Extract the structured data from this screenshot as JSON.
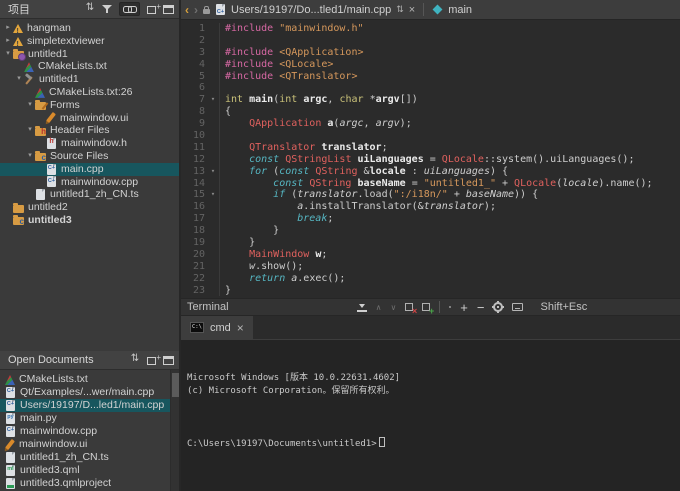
{
  "colors": {
    "selection_teal": "#17565e",
    "warning_yellow": "#e3a63c",
    "accent_teal": "#3fb3c0",
    "syntax_preprocessor": "#d668a3",
    "syntax_string": "#d6985c",
    "syntax_keyword_type": "#c9c179",
    "syntax_keyword_control": "#56b6c2",
    "syntax_qt_type": "#e0615e",
    "editor_bg": "#2b2b2b",
    "terminal_bg": "#242424",
    "panel_bg": "#3a3a3a"
  },
  "project_panel": {
    "title": "项目",
    "tree": [
      {
        "label": "hangman",
        "level": 0,
        "arrow": "collapsed",
        "icon": "warning"
      },
      {
        "label": "simpletextviewer",
        "level": 0,
        "arrow": "collapsed",
        "icon": "warning"
      },
      {
        "label": "untitled1",
        "level": 0,
        "arrow": "expanded",
        "icon": "folder-project"
      },
      {
        "label": "CMakeLists.txt",
        "level": 1,
        "arrow": "none",
        "icon": "cmake"
      },
      {
        "label": "untitled1",
        "level": 1,
        "arrow": "expanded",
        "icon": "hammer"
      },
      {
        "label": "CMakeLists.txt:26",
        "level": 2,
        "arrow": "none",
        "icon": "cmake"
      },
      {
        "label": "Forms",
        "level": 2,
        "arrow": "expanded",
        "icon": "folder-ui"
      },
      {
        "label": "mainwindow.ui",
        "level": 3,
        "arrow": "none",
        "icon": "ui"
      },
      {
        "label": "Header Files",
        "level": 2,
        "arrow": "expanded",
        "icon": "folder-h"
      },
      {
        "label": "mainwindow.h",
        "level": 3,
        "arrow": "none",
        "icon": "h"
      },
      {
        "label": "Source Files",
        "level": 2,
        "arrow": "expanded",
        "icon": "folder-c"
      },
      {
        "label": "main.cpp",
        "level": 3,
        "arrow": "none",
        "icon": "cpp",
        "selected": true
      },
      {
        "label": "mainwindow.cpp",
        "level": 3,
        "arrow": "none",
        "icon": "cpp"
      },
      {
        "label": "untitled1_zh_CN.ts",
        "level": 2,
        "arrow": "none",
        "icon": "doc"
      },
      {
        "label": "untitled2",
        "level": 0,
        "arrow": "none",
        "icon": "folder"
      },
      {
        "label": "untitled3",
        "level": 0,
        "arrow": "none",
        "icon": "folder-qml",
        "bold": true
      }
    ]
  },
  "open_documents": {
    "title": "Open Documents",
    "items": [
      {
        "label": "CMakeLists.txt",
        "icon": "cmake"
      },
      {
        "label": "Qt/Examples/...wer/main.cpp",
        "icon": "cpp"
      },
      {
        "label": "Users/19197/D...led1/main.cpp",
        "icon": "cpp",
        "selected": true
      },
      {
        "label": "main.py",
        "icon": "py"
      },
      {
        "label": "mainwindow.cpp",
        "icon": "cpp"
      },
      {
        "label": "mainwindow.ui",
        "icon": "ui"
      },
      {
        "label": "untitled1_zh_CN.ts",
        "icon": "doc"
      },
      {
        "label": "untitled3.qml",
        "icon": "qml"
      },
      {
        "label": "untitled3.qmlproject",
        "icon": "qmlproject"
      }
    ]
  },
  "editor": {
    "document_tab": {
      "label": "Users/19197/Do...tled1/main.cpp"
    },
    "symbol_tab": {
      "label": "main"
    },
    "fold_lines": [
      7,
      13,
      15
    ],
    "lines": [
      [
        [
          "pp",
          "#include"
        ],
        [
          "n",
          " "
        ],
        [
          "s",
          "\"mainwindow.h\""
        ]
      ],
      [],
      [
        [
          "pp",
          "#include"
        ],
        [
          "n",
          " "
        ],
        [
          "s",
          "<QApplication>"
        ]
      ],
      [
        [
          "pp",
          "#include"
        ],
        [
          "n",
          " "
        ],
        [
          "s",
          "<QLocale>"
        ]
      ],
      [
        [
          "pp",
          "#include"
        ],
        [
          "n",
          " "
        ],
        [
          "s",
          "<QTranslator>"
        ]
      ],
      [],
      [
        [
          "k",
          "int"
        ],
        [
          "n",
          " "
        ],
        [
          "d",
          "main"
        ],
        [
          "n",
          "("
        ],
        [
          "k",
          "int"
        ],
        [
          "n",
          " "
        ],
        [
          "d",
          "argc"
        ],
        [
          "n",
          ", "
        ],
        [
          "k",
          "char"
        ],
        [
          "n",
          " *"
        ],
        [
          "d",
          "argv"
        ],
        [
          "n",
          "[])"
        ]
      ],
      [
        [
          "n",
          "{"
        ]
      ],
      [
        [
          "n",
          "    "
        ],
        [
          "t",
          "QApplication"
        ],
        [
          "n",
          " "
        ],
        [
          "d",
          "a"
        ],
        [
          "n",
          "("
        ],
        [
          "u",
          "argc"
        ],
        [
          "n",
          ", "
        ],
        [
          "u",
          "argv"
        ],
        [
          "n",
          ");"
        ]
      ],
      [],
      [
        [
          "n",
          "    "
        ],
        [
          "t",
          "QTranslator"
        ],
        [
          "n",
          " "
        ],
        [
          "d",
          "translator"
        ],
        [
          "n",
          ";"
        ]
      ],
      [
        [
          "n",
          "    "
        ],
        [
          "c",
          "const"
        ],
        [
          "n",
          " "
        ],
        [
          "t",
          "QStringList"
        ],
        [
          "n",
          " "
        ],
        [
          "d",
          "uiLanguages"
        ],
        [
          "n",
          " = "
        ],
        [
          "t",
          "QLocale"
        ],
        [
          "n",
          "::system().uiLanguages();"
        ]
      ],
      [
        [
          "n",
          "    "
        ],
        [
          "c",
          "for"
        ],
        [
          "n",
          " ("
        ],
        [
          "c",
          "const"
        ],
        [
          "n",
          " "
        ],
        [
          "t",
          "QString"
        ],
        [
          "n",
          " &"
        ],
        [
          "d",
          "locale"
        ],
        [
          "n",
          " : "
        ],
        [
          "u",
          "uiLanguages"
        ],
        [
          "n",
          ") {"
        ]
      ],
      [
        [
          "n",
          "        "
        ],
        [
          "c",
          "const"
        ],
        [
          "n",
          " "
        ],
        [
          "t",
          "QString"
        ],
        [
          "n",
          " "
        ],
        [
          "d",
          "baseName"
        ],
        [
          "n",
          " = "
        ],
        [
          "s",
          "\"untitled1_\""
        ],
        [
          "n",
          " + "
        ],
        [
          "t",
          "QLocale"
        ],
        [
          "n",
          "("
        ],
        [
          "u",
          "locale"
        ],
        [
          "n",
          ").name();"
        ]
      ],
      [
        [
          "n",
          "        "
        ],
        [
          "c",
          "if"
        ],
        [
          "n",
          " ("
        ],
        [
          "u",
          "translator"
        ],
        [
          "n",
          ".load("
        ],
        [
          "s",
          "\":/i18n/\""
        ],
        [
          "n",
          " + "
        ],
        [
          "u",
          "baseName"
        ],
        [
          "n",
          ")) {"
        ]
      ],
      [
        [
          "n",
          "            "
        ],
        [
          "u",
          "a"
        ],
        [
          "n",
          ".installTranslator(&"
        ],
        [
          "u",
          "translator"
        ],
        [
          "n",
          ");"
        ]
      ],
      [
        [
          "n",
          "            "
        ],
        [
          "c",
          "break"
        ],
        [
          "n",
          ";"
        ]
      ],
      [
        [
          "n",
          "        }"
        ]
      ],
      [
        [
          "n",
          "    }"
        ]
      ],
      [
        [
          "n",
          "    "
        ],
        [
          "t",
          "MainWindow"
        ],
        [
          "n",
          " "
        ],
        [
          "d",
          "w"
        ],
        [
          "n",
          ";"
        ]
      ],
      [
        [
          "n",
          "    "
        ],
        [
          "u",
          "w"
        ],
        [
          "n",
          ".show();"
        ]
      ],
      [
        [
          "n",
          "    "
        ],
        [
          "c",
          "return"
        ],
        [
          "n",
          " "
        ],
        [
          "u",
          "a"
        ],
        [
          "n",
          ".exec();"
        ]
      ],
      [
        [
          "n",
          "}"
        ]
      ]
    ]
  },
  "terminal": {
    "panel_label": "Terminal",
    "shortcut": "Shift+Esc",
    "tab": {
      "label": "cmd"
    },
    "output": [
      "Microsoft Windows [版本 10.0.22631.4602]",
      "(c) Microsoft Corporation。保留所有权利。",
      ""
    ],
    "prompt": "C:\\Users\\19197\\Documents\\untitled1>"
  }
}
